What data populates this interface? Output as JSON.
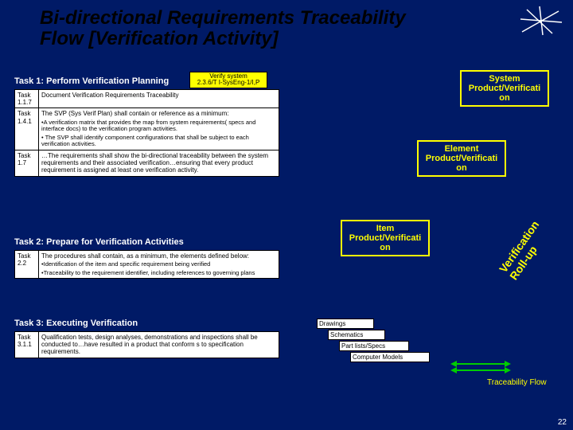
{
  "title_l1": "Bi-directional Requirements Traceability",
  "title_l2": "Flow [Verification Activity]",
  "verify_l1": "Verify system",
  "verify_l2": "2.3.6/T I-SysEng-1/I,P",
  "task1_h": "Task 1: Perform Verification Planning",
  "task2_h": "Task 2: Prepare for Verification Activities",
  "task3_h": "Task 3: Executing Verification",
  "t": {
    "r117": {
      "id": "Task 1.1.7",
      "txt": "Document Verification Requirements Traceability"
    },
    "r141": {
      "id": "Task 1.4.1",
      "txt": "The SVP (Sys Verif Plan) shall contain or reference as a minimum:",
      "s1": "•A verification matrix that provides the map from system requirements( specs and interface docs) to the verification program activities.",
      "s2": "• The SVP shall identify component configurations that shall be subject to each verification activities."
    },
    "r17": {
      "id": "Task 1.7",
      "txt": "…The requirements shall show the bi-directional traceability between the system requirements and their associated verification…ensuring that every product requirement is assigned at least one verification activity."
    },
    "r22": {
      "id": "Task 2.2",
      "txt": "The procedures shall contain, as a minimum, the elements defined below:",
      "s1": "•Identification of the item and specific requirement being verified",
      "s2": "•Traceability to the requirement identifier, including references to governing plans"
    },
    "r311": {
      "id": "Task 3.1.1",
      "txt": "Qualification tests, design analyses, demonstrations and inspections shall be conducted to…have resulted in a product that conform s to specification requirements."
    }
  },
  "boxes": {
    "sys": "System Product/Verificati on",
    "elem": "Element Product/Verificati on",
    "item": "Item Product/Verificati on"
  },
  "rot": "Verification Roll-up",
  "stack": {
    "a": "Drawings",
    "b": "Schematics",
    "c": "Part lists/Specs",
    "d": "Computer Models"
  },
  "flow": "Traceability Flow",
  "page": "22"
}
